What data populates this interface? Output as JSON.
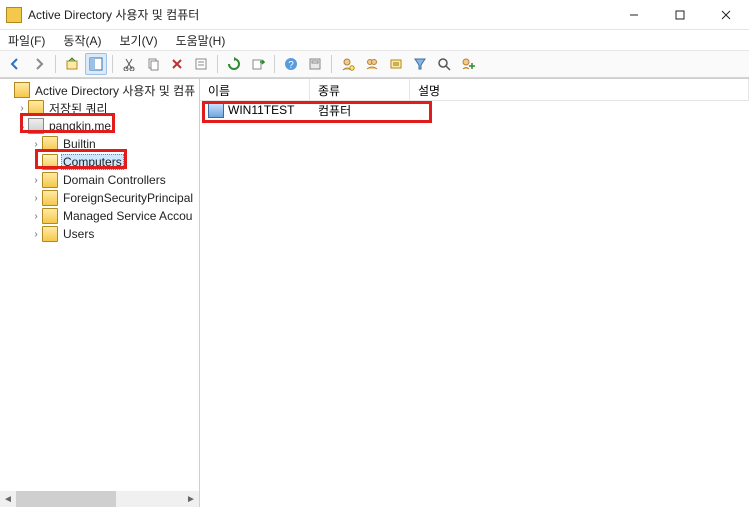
{
  "window": {
    "title": "Active Directory 사용자 및 컴퓨터"
  },
  "menu": {
    "file": "파일(F)",
    "action": "동작(A)",
    "view": "보기(V)",
    "help": "도움말(H)"
  },
  "tree": {
    "root": "Active Directory 사용자 및 컴퓨",
    "savedQueries": "저장된 쿼리",
    "domain": "pangkin.me",
    "children": {
      "builtin": "Builtin",
      "computers": "Computers",
      "domainControllers": "Domain Controllers",
      "foreignSecurity": "ForeignSecurityPrincipal",
      "managedService": "Managed Service Accou",
      "users": "Users"
    }
  },
  "list": {
    "columns": {
      "name": "이름",
      "type": "종류",
      "description": "설명"
    },
    "rows": [
      {
        "name": "WIN11TEST",
        "type": "컴퓨터",
        "description": ""
      }
    ]
  }
}
